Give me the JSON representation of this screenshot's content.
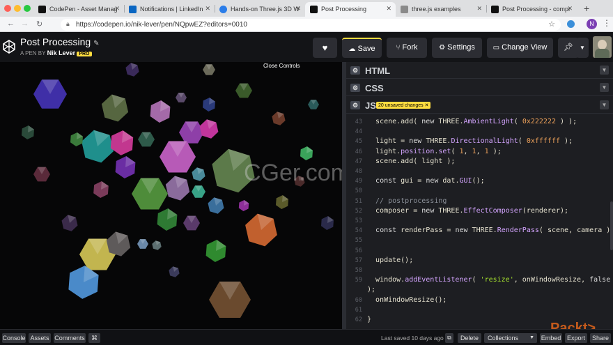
{
  "browser": {
    "tabs": [
      {
        "label": "CodePen - Asset Manag",
        "favicon_color": "#111111"
      },
      {
        "label": "Notifications | LinkedIn",
        "favicon_color": "#0a66c2"
      },
      {
        "label": "Hands-on Three.js 3D W",
        "favicon_color": "#2b7de9"
      },
      {
        "label": "Post Processing",
        "favicon_color": "#111111"
      },
      {
        "label": "three.js examples",
        "favicon_color": "#8a8a8a"
      },
      {
        "label": "Post Processing - compr",
        "favicon_color": "#111111"
      }
    ],
    "url": "https://codepen.io/nik-lever/pen/NQpwEZ?editors=0010",
    "avatar_letter": "N"
  },
  "pen": {
    "title": "Post Processing",
    "byline_prefix": "A PEN BY",
    "author": "Nik Lever",
    "badge": "PRO"
  },
  "header_buttons": {
    "save": "Save",
    "fork": "Fork",
    "settings": "Settings",
    "change_view": "Change View"
  },
  "preview": {
    "close_controls": "Close Controls",
    "watermark": "CGer.com"
  },
  "panels": {
    "html": "HTML",
    "css": "CSS",
    "js": "JS",
    "unsaved_badge": "20 unsaved changes"
  },
  "code": [
    {
      "n": "43",
      "t": "  scene.add( new THREE.AmbientLight( 0x222222 ) );"
    },
    {
      "n": "44",
      "t": ""
    },
    {
      "n": "45",
      "t": "  light = new THREE.DirectionalLight( 0xffffff );"
    },
    {
      "n": "46",
      "t": "  light.position.set( 1, 1, 1 );"
    },
    {
      "n": "47",
      "t": "  scene.add( light );"
    },
    {
      "n": "48",
      "t": ""
    },
    {
      "n": "49",
      "t": "  const gui = new dat.GUI();"
    },
    {
      "n": "50",
      "t": ""
    },
    {
      "n": "51",
      "t": "  // postprocessing"
    },
    {
      "n": "52",
      "t": "  composer = new THREE.EffectComposer(renderer);"
    },
    {
      "n": "53",
      "t": ""
    },
    {
      "n": "54",
      "t": "  const renderPass = new THREE.RenderPass( scene, camera );"
    },
    {
      "n": "55",
      "t": ""
    },
    {
      "n": "56",
      "t": ""
    },
    {
      "n": "57",
      "t": "  update();"
    },
    {
      "n": "58",
      "t": ""
    },
    {
      "n": "59",
      "t": "  window.addEventListener( 'resize', onWindowResize, false"
    },
    {
      "n": "",
      "t": ");"
    },
    {
      "n": "60",
      "t": "  onWindowResize();"
    },
    {
      "n": "61",
      "t": ""
    },
    {
      "n": "62",
      "t": "}"
    }
  ],
  "footer": {
    "console": "Console",
    "assets": "Assets",
    "comments": "Comments",
    "shortcut_icon": "⌘",
    "last_saved": "Last saved 10 days ago",
    "delete": "Delete",
    "collections": "Collections",
    "embed": "Embed",
    "export": "Export",
    "share": "Share"
  },
  "overlay_logo": "Packt>",
  "colors": {
    "accent_yellow": "#ffdd40",
    "code_bg": "#1d1e22",
    "header_bg": "#131417"
  }
}
